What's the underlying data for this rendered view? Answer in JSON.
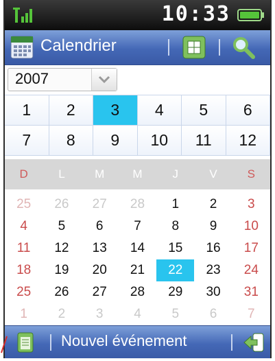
{
  "status": {
    "time": "10:33",
    "icons": [
      "signal-icon",
      "battery-icon"
    ]
  },
  "header": {
    "title": "Calendrier",
    "icons": [
      "calendar-app-icon",
      "month-view-icon",
      "search-icon"
    ]
  },
  "year_select": {
    "value": "2007"
  },
  "months": {
    "items": [
      "1",
      "2",
      "3",
      "4",
      "5",
      "6",
      "7",
      "8",
      "9",
      "10",
      "11",
      "12"
    ],
    "selected": "3"
  },
  "weekdays": [
    "D",
    "L",
    "M",
    "M",
    "J",
    "V",
    "S"
  ],
  "days": [
    [
      "25",
      "26",
      "27",
      "28",
      "1",
      "2",
      "3"
    ],
    [
      "4",
      "5",
      "6",
      "7",
      "8",
      "9",
      "10"
    ],
    [
      "11",
      "12",
      "13",
      "14",
      "15",
      "16",
      "17"
    ],
    [
      "18",
      "19",
      "20",
      "21",
      "22",
      "23",
      "24"
    ],
    [
      "25",
      "26",
      "27",
      "28",
      "29",
      "30",
      "31"
    ],
    [
      "1",
      "2",
      "3",
      "4",
      "5",
      "6",
      "7"
    ]
  ],
  "today": "22",
  "footer": {
    "new_event_label": "Nouvel événement",
    "icons": [
      "notes-icon",
      "back-icon"
    ]
  },
  "colors": {
    "accent": "#29c4ee",
    "bar": "#4468b6",
    "weekend": "#c94b4b"
  }
}
